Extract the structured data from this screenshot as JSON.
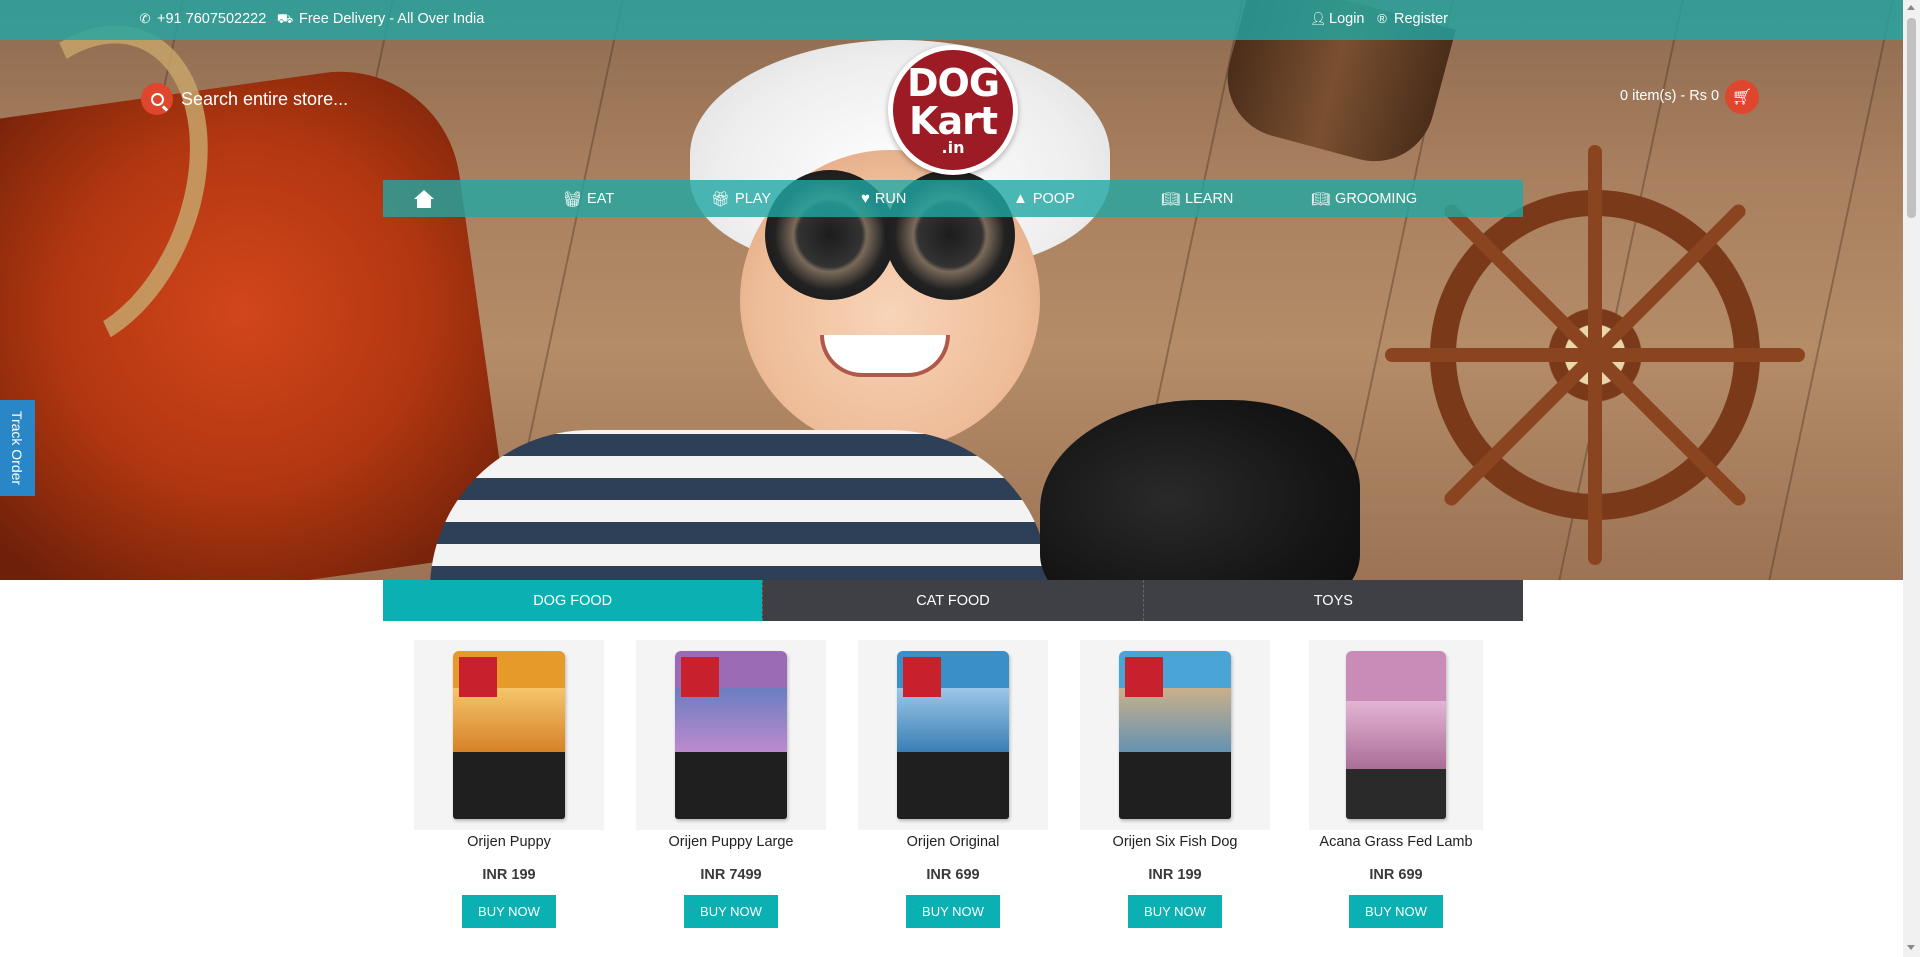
{
  "topbar": {
    "phone": "+91 7607502222",
    "delivery": "Free Delivery - All Over India",
    "login": "Login",
    "register": "Register"
  },
  "search": {
    "placeholder": "Search entire store..."
  },
  "logo": {
    "line1": "DOG",
    "line2": "Kart",
    "line3": ".in"
  },
  "cart": {
    "summary": "0 item(s) - Rs 0"
  },
  "nav": {
    "items": [
      {
        "label": "EAT",
        "icon": "basket-icon"
      },
      {
        "label": "PLAY",
        "icon": "gift-icon"
      },
      {
        "label": "RUN",
        "icon": "heart-icon"
      },
      {
        "label": "POOP",
        "icon": "poop-icon"
      },
      {
        "label": "LEARN",
        "icon": "book-icon"
      },
      {
        "label": "GROOMING",
        "icon": "book-icon"
      }
    ]
  },
  "track_order": "Track Order",
  "tabs": [
    {
      "label": "DOG FOOD",
      "active": true
    },
    {
      "label": "CAT FOOD",
      "active": false
    },
    {
      "label": "TOYS",
      "active": false
    }
  ],
  "products": [
    {
      "name": "Orijen Puppy",
      "price": "INR 199",
      "button": "BUY NOW",
      "color": "#e59a2a"
    },
    {
      "name": "Orijen Puppy Large",
      "price": "INR 7499",
      "button": "BUY NOW",
      "color": "#9b6bb5"
    },
    {
      "name": "Orijen Original",
      "price": "INR 699",
      "button": "BUY NOW",
      "color": "#3b8fc9"
    },
    {
      "name": "Orijen Six Fish Dog",
      "price": "INR 199",
      "button": "BUY NOW",
      "color": "#4aa4d6"
    },
    {
      "name": "Acana Grass Fed Lamb",
      "price": "INR 699",
      "button": "BUY NOW",
      "color": "#c98bb8"
    }
  ],
  "colors": {
    "teal": "#20a8a4",
    "accent_red": "#e0462d",
    "logo_red": "#9c1b25",
    "tab_dark": "#3f3f46",
    "tab_active": "#0bb0b3",
    "track_blue": "#2a87c7"
  }
}
